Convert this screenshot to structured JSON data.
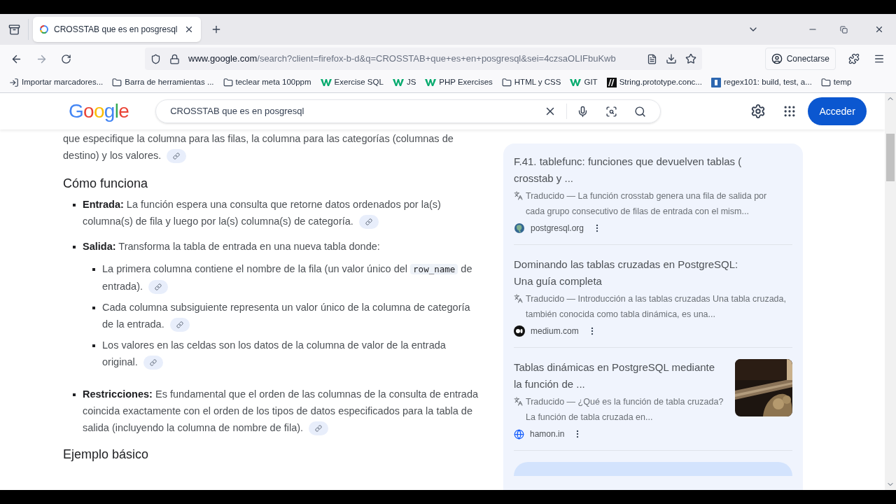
{
  "browser": {
    "tab": {
      "title": "CROSSTAB que es en posgresql",
      "selected": true
    },
    "url": {
      "host": "www.google.com",
      "path": "/search?client=firefox-b-d&q=CROSSTAB+que+es+en+posgresql&sei=4czsaOLIFbuKwb"
    },
    "account": "Conectarse",
    "bookmarks": [
      {
        "label": "Importar marcadores...",
        "kind": "import"
      },
      {
        "label": "Barra de herramientas ...",
        "kind": "folder"
      },
      {
        "label": "teclear meta 100ppm",
        "kind": "folder"
      },
      {
        "label": "Exercise SQL",
        "kind": "w3"
      },
      {
        "label": "JS",
        "kind": "w3"
      },
      {
        "label": "PHP Exercises",
        "kind": "w3"
      },
      {
        "label": "HTML y CSS",
        "kind": "folder"
      },
      {
        "label": "GIT",
        "kind": "w3"
      },
      {
        "label": "String.prototype.conc...",
        "kind": "mdn"
      },
      {
        "label": "regex101: build, test, a...",
        "kind": "regex"
      },
      {
        "label": "temp",
        "kind": "folder"
      }
    ]
  },
  "google": {
    "logo": "Google",
    "query": "CROSSTAB que es en posgresql",
    "sign_in": "Acceder"
  },
  "article": {
    "intro": "que especifique la columna para las filas, la columna para las categorías (columnas de destino) y los valores.",
    "heading": "Cómo funciona",
    "items": [
      {
        "label": "Entrada:",
        "text": "La función espera una consulta que retorne datos ordenados por la(s) columna(s) de fila y luego por la(s) columna(s) de categoría.",
        "link": true
      },
      {
        "label": "Salida:",
        "text": "Transforma la tabla de entrada en una nueva tabla donde:",
        "link": false,
        "children": [
          {
            "before": "La primera columna contiene el nombre de la fila (un valor único del",
            "code": "row_name",
            "after": "de entrada)."
          },
          {
            "before": "Cada columna subsiguiente representa un valor único de la columna de categoría de la entrada."
          },
          {
            "before": "Los valores en las celdas son los datos de la columna de valor de la entrada original."
          }
        ]
      },
      {
        "label": "Restricciones:",
        "text": "Es fundamental que el orden de las columnas de la consulta de entrada coincida exactamente con el orden de los tipos de datos especificados para la tabla de salida (incluyendo la columna de nombre de fila).",
        "link": true
      }
    ],
    "heading_2": "Ejemplo básico"
  },
  "results": [
    {
      "title": "F.41. tablefunc: funciones que devuelven tablas ( crosstab y ...",
      "translated": "Traducido",
      "snippet": "— La función crosstab genera una fila de salida por cada grupo consecutivo de filas de entrada con el mism...",
      "source": "postgresql.org",
      "thumbnail": false
    },
    {
      "title": "Dominando las tablas cruzadas en PostgreSQL: Una guía completa",
      "translated": "Traducido",
      "snippet": "— Introducción a las tablas cruzadas Una tabla cruzada, también conocida como tabla dinámica, es una...",
      "source": "medium.com",
      "thumbnail": false
    },
    {
      "title": "Tablas dinámicas en PostgreSQL mediante la función de ...",
      "translated": "Traducido",
      "snippet": "— ¿Qué es la función de tabla cruzada? La función de tabla cruzada en...",
      "source": "hamon.in",
      "thumbnail": true
    }
  ]
}
